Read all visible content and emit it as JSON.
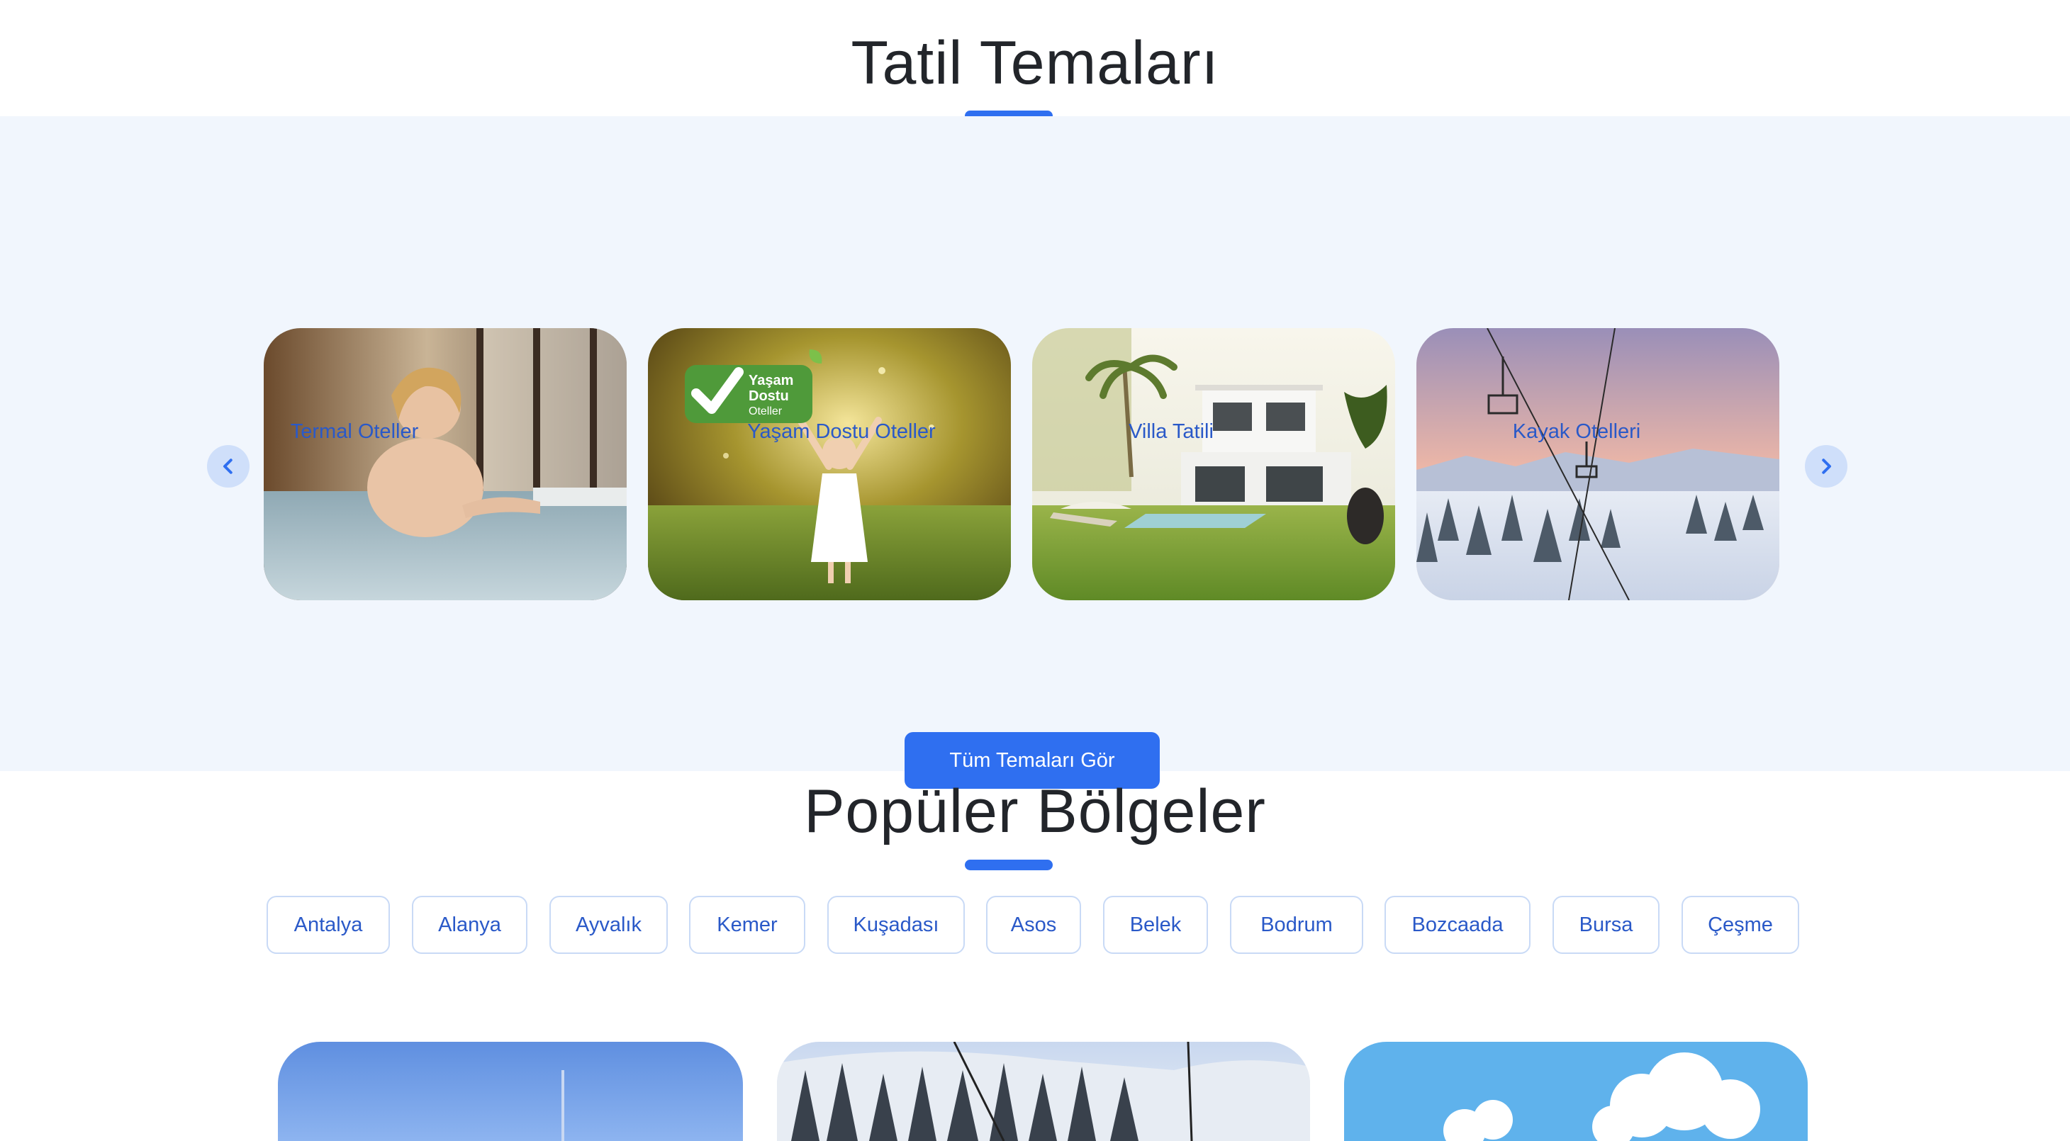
{
  "themes": {
    "title": "Tatil Temaları",
    "prev_icon": "chevron-left-icon",
    "next_icon": "chevron-right-icon",
    "cards": [
      {
        "label": "Termal Oteller",
        "image": "woman relaxing in thermal pool"
      },
      {
        "label": "Yaşam Dostu Oteller",
        "image": "girl in sunny forest",
        "badge": {
          "line1": "Yaşam",
          "line2": "Dostu",
          "line3": "Oteller"
        }
      },
      {
        "label": "Villa Tatili",
        "image": "white villa with pool and garden"
      },
      {
        "label": "Kayak Otelleri",
        "image": "ski lift over snowy forest"
      }
    ],
    "cta_label": "Tüm Temaları Gör"
  },
  "regions": {
    "title": "Popüler Bölgeler",
    "chips": [
      "Antalya",
      "Alanya",
      "Ayvalık",
      "Kemer",
      "Kuşadası",
      "Asos",
      "Belek",
      "Bodrum",
      "Bozcaada",
      "Bursa",
      "Çeşme"
    ]
  },
  "colors": {
    "accent": "#2f6ff0",
    "link": "#2a59c8",
    "band": "#f1f6fd",
    "chip_border": "#c9daf6"
  }
}
